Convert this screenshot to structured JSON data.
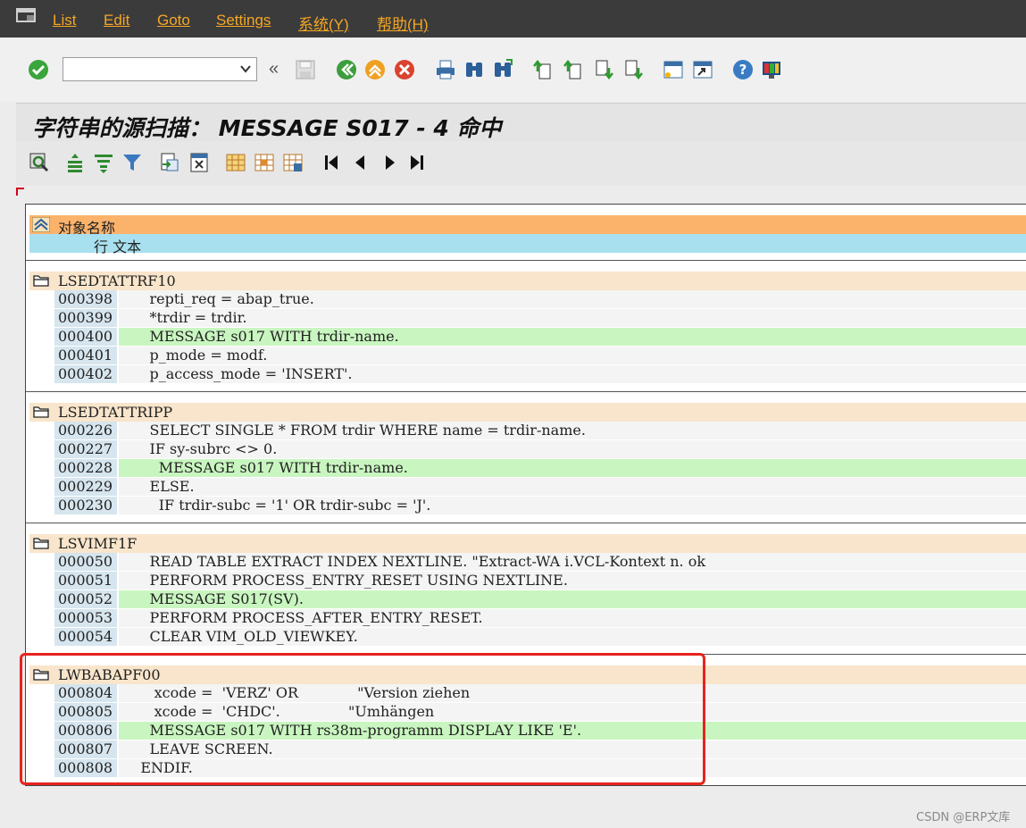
{
  "menubar": {
    "items": [
      "List",
      "Edit",
      "Goto",
      "Settings",
      "系统(Y)",
      "帮助(H)"
    ]
  },
  "toolbar": {
    "command_value": "",
    "back_arrows": "«"
  },
  "page": {
    "title": "字符串的源扫描： MESSAGE S017 - 4 命中"
  },
  "list": {
    "header_object": "对象名称",
    "header_line": "行 文本",
    "groups": [
      {
        "name": "LSEDTATTRF10",
        "rows": [
          {
            "num": "000398",
            "code": "      repti_req = abap_true."
          },
          {
            "num": "000399",
            "code": "      *trdir = trdir."
          },
          {
            "num": "000400",
            "code": "      MESSAGE s017 WITH trdir-name.",
            "hit": true
          },
          {
            "num": "000401",
            "code": "      p_mode = modf."
          },
          {
            "num": "000402",
            "code": "      p_access_mode = 'INSERT'."
          }
        ]
      },
      {
        "name": "LSEDTATTRIPP",
        "rows": [
          {
            "num": "000226",
            "code": "      SELECT SINGLE * FROM trdir WHERE name = trdir-name."
          },
          {
            "num": "000227",
            "code": "      IF sy-subrc <> 0."
          },
          {
            "num": "000228",
            "code": "        MESSAGE s017 WITH trdir-name.",
            "hit": true
          },
          {
            "num": "000229",
            "code": "      ELSE."
          },
          {
            "num": "000230",
            "code": "        IF trdir-subc = '1' OR trdir-subc = 'J'."
          }
        ]
      },
      {
        "name": "LSVIMF1F",
        "rows": [
          {
            "num": "000050",
            "code": "      READ TABLE EXTRACT INDEX NEXTLINE. \"Extract-WA i.VCL-Kontext n. ok"
          },
          {
            "num": "000051",
            "code": "      PERFORM PROCESS_ENTRY_RESET USING NEXTLINE."
          },
          {
            "num": "000052",
            "code": "      MESSAGE S017(SV).",
            "hit": true
          },
          {
            "num": "000053",
            "code": "      PERFORM PROCESS_AFTER_ENTRY_RESET."
          },
          {
            "num": "000054",
            "code": "      CLEAR VIM_OLD_VIEWKEY."
          }
        ]
      },
      {
        "name": "LWBABAPF00",
        "rows": [
          {
            "num": "000804",
            "code": "       xcode =  'VERZ' OR             \"Version ziehen"
          },
          {
            "num": "000805",
            "code": "       xcode =  'CHDC'.               \"Umhängen"
          },
          {
            "num": "000806",
            "code": "      MESSAGE s017 WITH rs38m-programm DISPLAY LIKE 'E'.",
            "hit": true
          },
          {
            "num": "000807",
            "code": "      LEAVE SCREEN."
          },
          {
            "num": "000808",
            "code": "    ENDIF."
          }
        ]
      }
    ]
  },
  "watermark": "CSDN @ERP文库",
  "colors": {
    "menubar_bg": "#3b3b3b",
    "menu_text": "#f5a623",
    "header_object_bg": "#fbb26b",
    "header_line_bg": "#a8e0ef",
    "group_head_bg": "#f8e5cb",
    "hit_row_bg": "#c9f6c0",
    "annotation_border": "#e8231f"
  },
  "icons": {
    "toolbar": [
      "enter-check-icon",
      "save-icon",
      "back-icon",
      "exit-icon",
      "cancel-icon",
      "print-icon",
      "find-icon",
      "find-next-icon",
      "first-page-icon",
      "previous-page-icon",
      "next-page-icon",
      "last-page-icon",
      "create-session-icon",
      "shortcut-icon",
      "help-icon",
      "layout-icon"
    ],
    "apptoolbar": [
      "display-object-icon",
      "sort-ascending-icon",
      "sort-descending-icon",
      "filter-icon",
      "export-icon",
      "print-preview-icon",
      "layout-choose-icon",
      "layout-change-icon",
      "layout-save-icon",
      "first-icon",
      "previous-icon",
      "next-icon",
      "last-icon"
    ]
  }
}
